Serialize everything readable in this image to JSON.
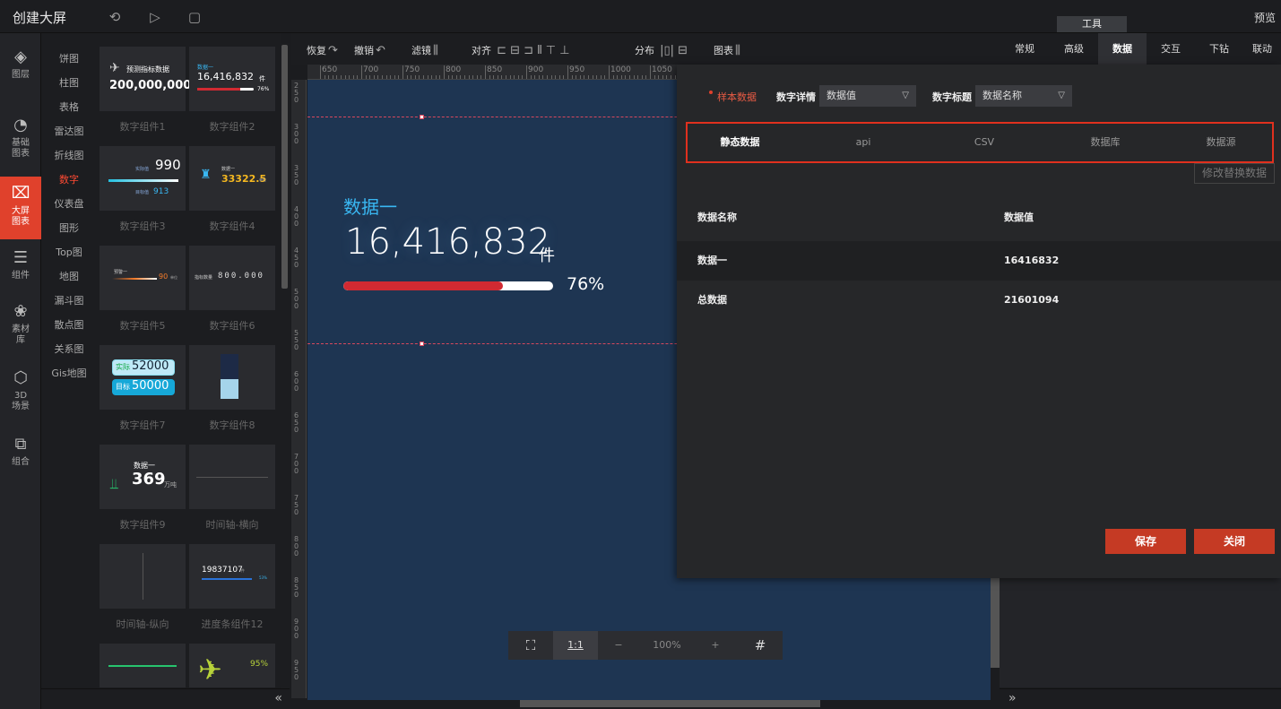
{
  "topbar": {
    "title": "创建大屏",
    "tools_tab": "工具",
    "preview": "预览",
    "icons": [
      "undo-icon",
      "play-icon",
      "save-icon"
    ]
  },
  "leftnav": [
    {
      "label": "图层",
      "icon": "layers-icon"
    },
    {
      "label": "基础\n图表",
      "icon": "pie-icon"
    },
    {
      "label": "大屏\n图表",
      "icon": "screen-chart-icon"
    },
    {
      "label": "组件",
      "icon": "sliders-icon"
    },
    {
      "label": "素材\n库",
      "icon": "assets-icon"
    },
    {
      "label": "3D\n场景",
      "icon": "cube-icon"
    },
    {
      "label": "组合",
      "icon": "group-icon"
    }
  ],
  "categories": [
    "饼图",
    "柱图",
    "表格",
    "雷达图",
    "折线图",
    "数字",
    "仪表盘",
    "图形",
    "Top图",
    "地图",
    "漏斗图",
    "散点图",
    "关系图",
    "Gis地图"
  ],
  "active_category": "数字",
  "components": [
    "数字组件1",
    "数字组件2",
    "数字组件3",
    "数字组件4",
    "数字组件5",
    "数字组件6",
    "数字组件7",
    "数字组件8",
    "数字组件9",
    "时间轴-横向",
    "时间轴-纵向",
    "进度条组件12"
  ],
  "thumbs": {
    "c1_label": "预测指标数据",
    "c1_value": "200,000,000",
    "c2_label": "数据一",
    "c2_value": "16,416,832",
    "c2_unit": "件",
    "c2_pct": "76%",
    "c3_value": "990",
    "c3_value2": "913",
    "c3_l1": "实际值",
    "c3_l2": "目标值",
    "c4_label": "数据一",
    "c4_value": "33322.5",
    "c4_unit": "单位",
    "c5_label": "预警一",
    "c5_value": "90",
    "c5_unit": "单位",
    "c6_label": "指标数量",
    "c6_value": "800.000",
    "c7_l1": "实际",
    "c7_v1": "52000",
    "c7_l2": "目标",
    "c7_v2": "50000",
    "c9_label": "数据一",
    "c9_value": "369",
    "c9_unit": "万吨",
    "c12_label": "数据一",
    "c12_value": "19837107",
    "c12_unit": "件",
    "c12_pct": "53%",
    "c14_pct": "95%"
  },
  "toolbar": {
    "restore": "恢复",
    "undo": "撤销",
    "filter": "滤镜",
    "align": "对齐",
    "distribute": "分布",
    "chart": "图表"
  },
  "ruler_h": [
    "650",
    "700",
    "750",
    "800",
    "850",
    "900",
    "950",
    "1000",
    "1050"
  ],
  "ruler_v": [
    "250",
    "300",
    "350",
    "400",
    "450",
    "500",
    "550",
    "600",
    "650",
    "700",
    "750",
    "800",
    "850",
    "900",
    "950",
    "1000"
  ],
  "widget": {
    "title": "数据一",
    "value": "16,416,832",
    "unit": "件",
    "percent_text": "76%",
    "progress": 0.76
  },
  "zoombar": {
    "fit_icon": "fit-screen-icon",
    "ratio": "1:1",
    "minus": "−",
    "zoom": "100%",
    "plus": "+",
    "grid_icon": "grid-icon"
  },
  "right_tabs": [
    "常规",
    "高级",
    "数据",
    "交互",
    "下钻",
    "联动"
  ],
  "active_right_tab": "数据",
  "data_panel": {
    "sample_label": "样本数据",
    "detail_label": "数字详情",
    "detail_value": "数据值",
    "title_label": "数字标题",
    "title_value": "数据名称",
    "source_tabs": [
      "静态数据",
      "api",
      "CSV",
      "数据库",
      "数据源"
    ],
    "active_source": "静态数据",
    "replace_button": "修改替换数据",
    "columns": [
      "数据名称",
      "数据值"
    ],
    "rows": [
      [
        "数据一",
        "16416832"
      ],
      [
        "总数据",
        "21601094"
      ]
    ],
    "save": "保存",
    "close": "关闭"
  },
  "colors": {
    "accent": "#e0412c",
    "canvas": "#1e3552",
    "title_blue": "#39b7f2",
    "bar_red": "#d12a32"
  }
}
